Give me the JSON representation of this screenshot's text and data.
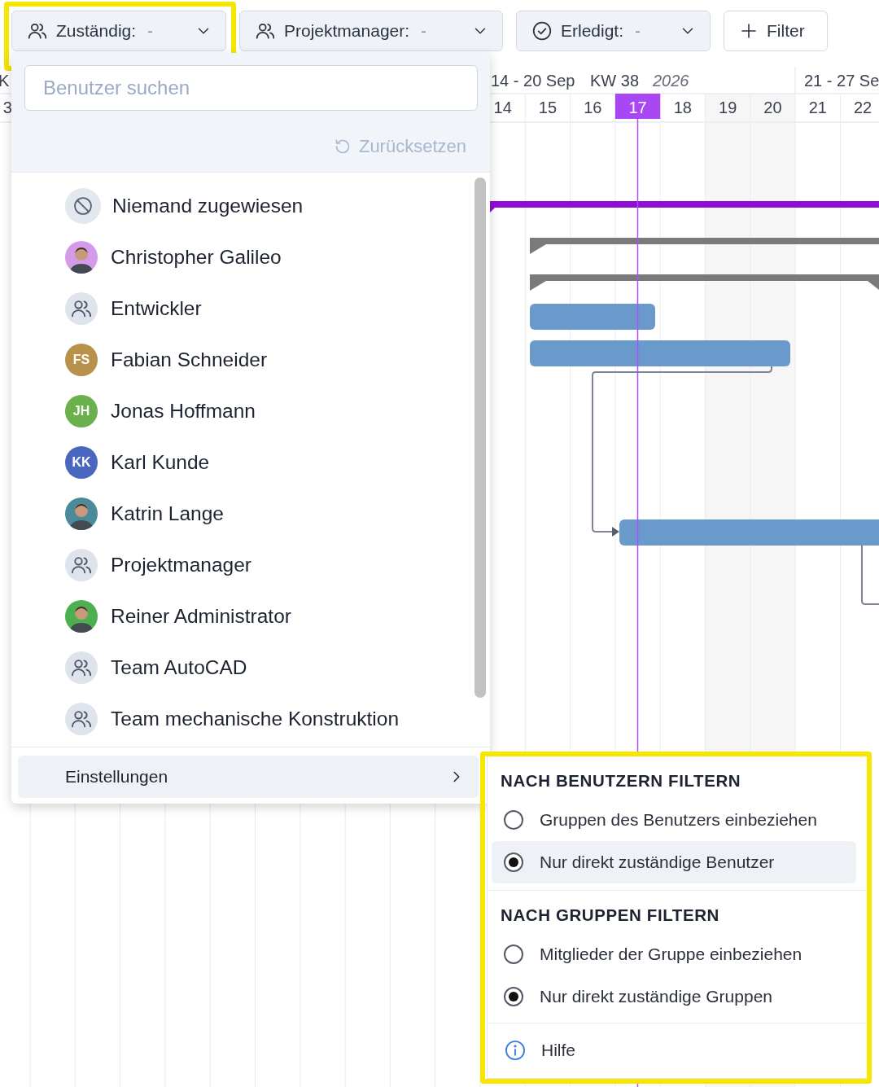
{
  "toolbar": {
    "filters": [
      {
        "kind": "people",
        "label": "Zuständig:",
        "value": "-",
        "highlighted": true
      },
      {
        "kind": "people",
        "label": "Projektmanager:",
        "value": "-",
        "highlighted": false
      },
      {
        "kind": "check",
        "label": "Erledigt:",
        "value": "-",
        "highlighted": false
      }
    ],
    "add_filter": {
      "label": "Filter"
    }
  },
  "timeline": {
    "weeks": [
      {
        "label": "K"
      },
      {
        "label": "14 - 20 Sep",
        "week": "KW 38",
        "year": "2026"
      },
      {
        "label": "21 - 27 Se"
      }
    ],
    "days": [
      {
        "label": "3",
        "selected": false
      },
      {
        "label": "14",
        "selected": false
      },
      {
        "label": "15",
        "selected": false
      },
      {
        "label": "16",
        "selected": false
      },
      {
        "label": "17",
        "selected": true
      },
      {
        "label": "18",
        "selected": false
      },
      {
        "label": "19",
        "selected": false
      },
      {
        "label": "20",
        "selected": false
      },
      {
        "label": "21",
        "selected": false
      },
      {
        "label": "22",
        "selected": false
      }
    ]
  },
  "user_dropdown": {
    "search": {
      "placeholder": "Benutzer suchen"
    },
    "reset": {
      "label": "Zurücksetzen"
    },
    "users": [
      {
        "kind": "none",
        "name": "Niemand zugewiesen"
      },
      {
        "kind": "photo",
        "name": "Christopher Galileo",
        "color": "#d59be8"
      },
      {
        "kind": "group",
        "name": "Entwickler"
      },
      {
        "kind": "initials",
        "name": "Fabian Schneider",
        "initials": "FS",
        "color": "#b8914a"
      },
      {
        "kind": "initials",
        "name": "Jonas Hoffmann",
        "initials": "JH",
        "color": "#6ab04c"
      },
      {
        "kind": "initials",
        "name": "Karl Kunde",
        "initials": "KK",
        "color": "#4a67c0"
      },
      {
        "kind": "photo",
        "name": "Katrin Lange",
        "color": "#4a8a9a"
      },
      {
        "kind": "group",
        "name": "Projektmanager"
      },
      {
        "kind": "photo",
        "name": "Reiner Administrator",
        "color": "#4caf50"
      },
      {
        "kind": "group",
        "name": "Team AutoCAD"
      },
      {
        "kind": "group",
        "name": "Team mechanische Konstruktion"
      }
    ],
    "settings": {
      "label": "Einstellungen",
      "selected": true
    }
  },
  "settings_menu": {
    "highlighted": true,
    "sections": [
      {
        "title": "NACH BENUTZERN FILTERN",
        "options": [
          {
            "label": "Gruppen des Benutzers einbeziehen",
            "selected": false,
            "hovered": false
          },
          {
            "label": "Nur direkt zuständige Benutzer",
            "selected": true,
            "hovered": true
          }
        ]
      },
      {
        "title": "NACH GRUPPEN FILTERN",
        "options": [
          {
            "label": "Mitglieder der Gruppe einbeziehen",
            "selected": false,
            "hovered": false
          },
          {
            "label": "Nur direkt zuständige Gruppen",
            "selected": true,
            "hovered": false
          }
        ]
      }
    ],
    "help": {
      "label": "Hilfe"
    }
  }
}
